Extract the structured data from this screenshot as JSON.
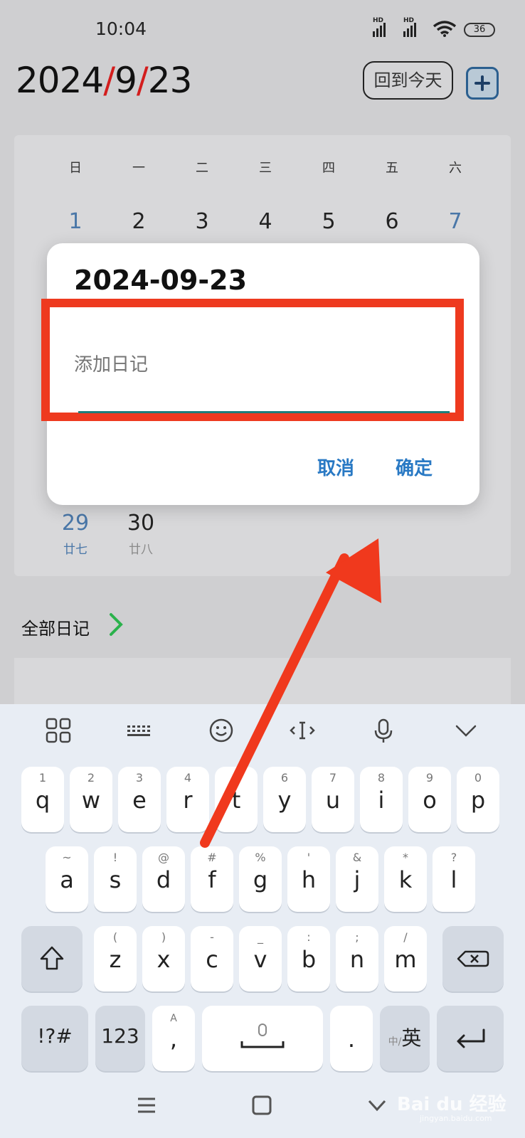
{
  "status_bar": {
    "time": "10:04",
    "battery": "36",
    "hd1": "HD",
    "hd2": "HD"
  },
  "header": {
    "date_y": "2024",
    "slash": "/",
    "date_m": "9",
    "date_d": "23",
    "today_button": "回到今天"
  },
  "calendar": {
    "weekdays": [
      "日",
      "一",
      "二",
      "三",
      "四",
      "五",
      "六"
    ],
    "row1": [
      "1",
      "2",
      "3",
      "4",
      "5",
      "6",
      "7"
    ],
    "last_row": [
      {
        "day": "29",
        "lunar": "廿七"
      },
      {
        "day": "30",
        "lunar": "廿八"
      }
    ]
  },
  "all_diary": "全部日记",
  "dialog": {
    "title": "2024-09-23",
    "placeholder": "添加日记",
    "cancel": "取消",
    "confirm": "确定"
  },
  "keyboard": {
    "row1": [
      {
        "num": "1",
        "key": "q"
      },
      {
        "num": "2",
        "key": "w"
      },
      {
        "num": "3",
        "key": "e"
      },
      {
        "num": "4",
        "key": "r"
      },
      {
        "num": "5",
        "key": "t"
      },
      {
        "num": "6",
        "key": "y"
      },
      {
        "num": "7",
        "key": "u"
      },
      {
        "num": "8",
        "key": "i"
      },
      {
        "num": "9",
        "key": "o"
      },
      {
        "num": "0",
        "key": "p"
      }
    ],
    "row2": [
      {
        "sym": "~",
        "key": "a"
      },
      {
        "sym": "!",
        "key": "s"
      },
      {
        "sym": "@",
        "key": "d"
      },
      {
        "sym": "#",
        "key": "f"
      },
      {
        "sym": "%",
        "key": "g"
      },
      {
        "sym": "'",
        "key": "h"
      },
      {
        "sym": "&",
        "key": "j"
      },
      {
        "sym": "*",
        "key": "k"
      },
      {
        "sym": "?",
        "key": "l"
      }
    ],
    "row3": [
      {
        "sym": "(",
        "key": "z"
      },
      {
        "sym": ")",
        "key": "x"
      },
      {
        "sym": "-",
        "key": "c"
      },
      {
        "sym": "_",
        "key": "v"
      },
      {
        "sym": ":",
        "key": "b"
      },
      {
        "sym": ";",
        "key": "n"
      },
      {
        "sym": "/",
        "key": "m"
      }
    ],
    "symbols_key": "!?#",
    "num_key": "123",
    "comma_sub": "A",
    "comma": ",",
    "period": ".",
    "lang_small": "中/",
    "lang_big": "英"
  },
  "watermark": {
    "text": "Bai du 经验",
    "sub": "jingyan.baidu.com"
  }
}
